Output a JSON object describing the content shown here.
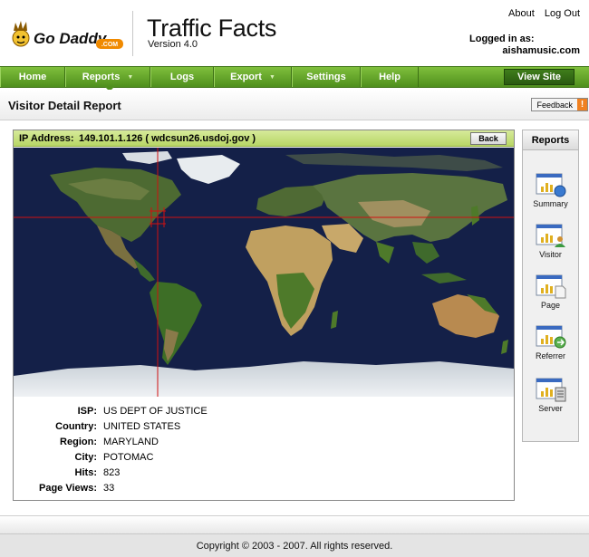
{
  "brand": {
    "logo_text": "Go Daddy",
    "logo_suffix": ".COM",
    "app_title": "Traffic Facts",
    "version": "Version 4.0"
  },
  "top_links": {
    "about": "About",
    "logout": "Log Out",
    "logged_in_label": "Logged in as:",
    "user": "aishamusic.com"
  },
  "nav": {
    "home": "Home",
    "reports": "Reports",
    "logs": "Logs",
    "export": "Export",
    "settings": "Settings",
    "help": "Help",
    "view_site": "View Site",
    "dropdown_glyph": "▼"
  },
  "title_bar": {
    "title": "Visitor Detail Report",
    "feedback": "Feedback",
    "feedback_badge": "!"
  },
  "detail": {
    "ip_label": "IP Address:",
    "ip_value": "149.101.1.126  ( wdcsun26.usdoj.gov )",
    "back": "Back",
    "rows": [
      {
        "label": "ISP:",
        "value": "US DEPT OF JUSTICE"
      },
      {
        "label": "Country:",
        "value": "UNITED STATES"
      },
      {
        "label": "Region:",
        "value": "MARYLAND"
      },
      {
        "label": "City:",
        "value": "POTOMAC"
      },
      {
        "label": "Hits:",
        "value": "823"
      },
      {
        "label": "Page Views:",
        "value": "33"
      }
    ]
  },
  "side": {
    "title": "Reports",
    "items": [
      {
        "label": "Summary",
        "icon": "summary-chart-icon"
      },
      {
        "label": "Visitor",
        "icon": "visitor-chart-icon"
      },
      {
        "label": "Page",
        "icon": "page-chart-icon"
      },
      {
        "label": "Referrer",
        "icon": "referrer-chart-icon"
      },
      {
        "label": "Server",
        "icon": "server-chart-icon"
      }
    ]
  },
  "footer": {
    "copyright": "Copyright © 2003 - 2007. All rights reserved."
  },
  "colors": {
    "nav_green": "#5e9e27",
    "ip_bar": "#c6e07c",
    "ocean": "#142048",
    "marker": "#d01010"
  }
}
